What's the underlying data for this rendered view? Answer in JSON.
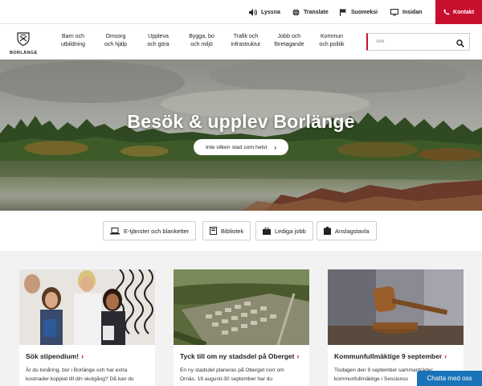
{
  "utility": {
    "listen": "Lyssna",
    "translate": "Translate",
    "finnish": "Suomeksi",
    "intranet": "Insidan",
    "contact": "Kontakt",
    "contact_color": "#c8102e"
  },
  "logo": {
    "text": "BORLÄNGE",
    "icon": "coat-of-arms-icon"
  },
  "nav": [
    {
      "line1": "Barn och",
      "line2": "utbildning"
    },
    {
      "line1": "Omsorg",
      "line2": "och hjälp"
    },
    {
      "line1": "Uppleva",
      "line2": "och göra"
    },
    {
      "line1": "Bygga, bo",
      "line2": "och miljö"
    },
    {
      "line1": "Trafik och",
      "line2": "infrastruktur"
    },
    {
      "line1": "Jobb och",
      "line2": "företagande"
    },
    {
      "line1": "Kommun",
      "line2": "och politik"
    }
  ],
  "search": {
    "placeholder": "Sök"
  },
  "hero": {
    "title": "Besök & upplev Borlänge",
    "button": "Inte vilken stad som helst"
  },
  "quicklinks": [
    {
      "label": "E-tjänster och blanketter",
      "icon": "laptop-icon"
    },
    {
      "label": "Bibliotek",
      "icon": "book-icon"
    },
    {
      "label": "Lediga jobb",
      "icon": "briefcase-icon"
    },
    {
      "label": "Anslagstavla",
      "icon": "notice-board-icon"
    }
  ],
  "cards": [
    {
      "title": "Sök stipendium!",
      "text1": "Är du tonåring, bor i Borlänge och har extra",
      "text2": "kostnader kopplat till din skolgång? Då kan du"
    },
    {
      "title": "Tyck till om ny stadsdel på Oberget",
      "text1": "En ny stadsdel planeras på Oberget norr om",
      "text2": "Ornäs. 19 augusti-30 september har du"
    },
    {
      "title": "Kommunfullmäktige 9 september",
      "text1": "Tisdagen den 9 september sammanträder",
      "text2": "kommunfullmäktige i Sessionss"
    }
  ],
  "chat": {
    "label": "Chatta med oss",
    "color": "#1a73b8"
  }
}
